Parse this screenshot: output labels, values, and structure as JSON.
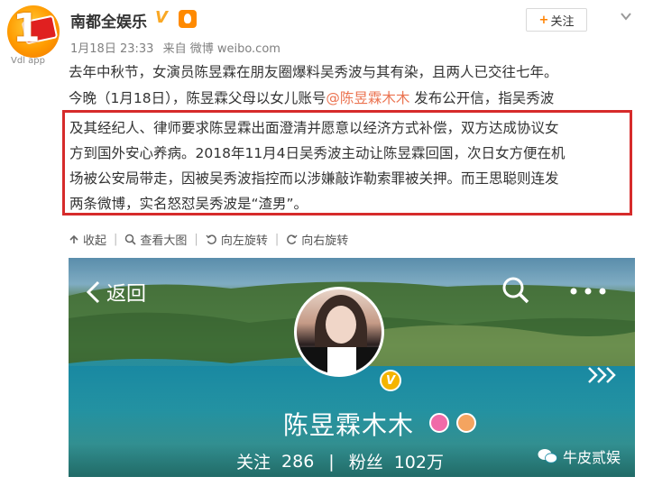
{
  "header": {
    "account_name": "南都全娱乐",
    "avatar_text": "1",
    "avatar_sub": "Vdl app",
    "meta_date": "1月18日 23:33",
    "meta_source": "来自 微博 weibo.com",
    "follow_label": "关注"
  },
  "post": {
    "line1": "去年中秋节，女演员陈昱霖在朋友圈爆料吴秀波与其有染，且两人已交往七年。",
    "line2_before": "今晚（1月18日），陈昱霖父母以女儿账号",
    "mention": "@陈昱霖木木",
    "line2_after": " 发布公开信，指吴秀波",
    "quote_line1": "及其经纪人、律师要求陈昱霖出面澄清并愿意以经济方式补偿，双方达成协议女",
    "quote_line2": "方到国外安心养病。2018年11月4日吴秀波主动让陈昱霖回国，次日女方便在机",
    "quote_line3": "场被公安局带走，因被吴秀波指控而以涉嫌敲诈勒索罪被关押。而王思聪则连发",
    "quote_line4": "两条微博，实名怒怼吴秀波是“渣男”。"
  },
  "toolbar": {
    "collect": "收起",
    "view_large": "查看大图",
    "rotate_left": "向左旋转",
    "rotate_right": "向右旋转"
  },
  "image": {
    "back_label": "返回",
    "profile_name": "陈昱霖木木",
    "following_label": "关注",
    "following_count": "286",
    "stat_separator": "|",
    "fans_label": "粉丝",
    "fans_count": "102万",
    "watermark": "牛皮贰娱"
  },
  "colors": {
    "mention": "#eb7350",
    "highlight_box": "#d62b2b",
    "follow_plus": "#ff8200"
  }
}
